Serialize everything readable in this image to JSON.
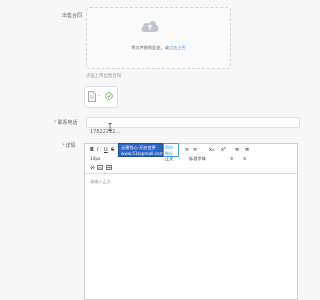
{
  "labels": {
    "contract": "出售合同",
    "phone": "联系电话",
    "details": "详情"
  },
  "upload": {
    "text": "将文件拖到此处，或",
    "link": "点击上传",
    "hint": "点击上传出售合同"
  },
  "phone": {
    "value": "17822222..."
  },
  "editor": {
    "placeholder": "请输入正文",
    "toolbar_row1": [
      "B",
      "I",
      "U",
      "S",
      "A",
      "A",
      "A",
      "“",
      "T",
      "H1",
      "≡",
      "≡",
      "x₂",
      "x²",
      "≣",
      "≣"
    ],
    "font_size": "14px",
    "normal_label": "正文",
    "font_label": "标准字体"
  },
  "tooltip": {
    "line1": "无需找心·开启变更",
    "line2": "www.51topmall.com",
    "side1": "帮你",
    "side2": "做好"
  },
  "colors": {
    "accent": "#409eff",
    "success": "#67c23a",
    "required": "#f56c6c"
  }
}
